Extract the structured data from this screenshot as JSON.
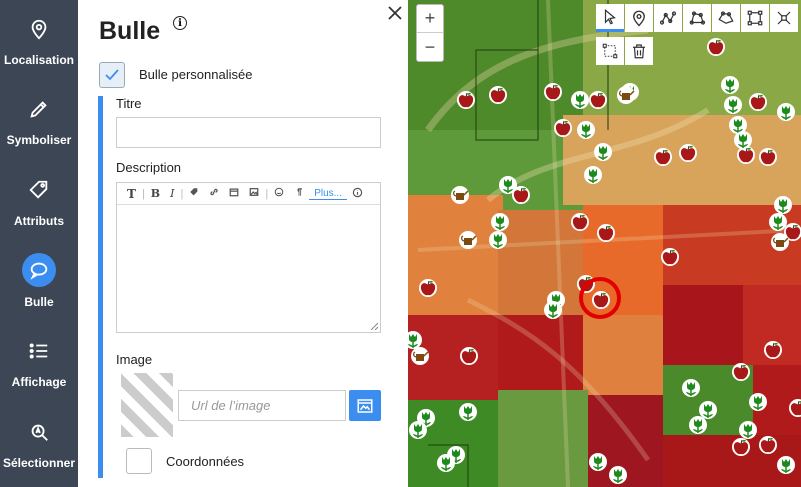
{
  "nav": {
    "items": [
      {
        "label": "Localisation",
        "icon": "location-pin-icon"
      },
      {
        "label": "Symboliser",
        "icon": "pencil-icon"
      },
      {
        "label": "Attributs",
        "icon": "tag-icon"
      },
      {
        "label": "Bulle",
        "icon": "speech-bubble-icon",
        "active": true
      },
      {
        "label": "Affichage",
        "icon": "list-icon"
      },
      {
        "label": "Sélectionner",
        "icon": "select-icon"
      }
    ]
  },
  "panel": {
    "title": "Bulle",
    "custom_bubble_label": "Bulle personnalisée",
    "custom_bubble_checked": true,
    "title_label": "Titre",
    "title_value": "",
    "description_label": "Description",
    "toolbar": [
      "T",
      "B",
      "I",
      "Plus..."
    ],
    "image_label": "Image",
    "url_placeholder": "Url de l’image",
    "coords_label": "Coordonnées",
    "coords_checked": false
  },
  "map": {
    "zoom_in": "+",
    "zoom_out": "−",
    "tools": [
      "select-tool-icon",
      "marker-tool-icon",
      "line-tool-icon",
      "polygon-tool-icon",
      "shape-tool-icon",
      "rectangle-tool-icon",
      "fit-tool-icon",
      "box-select-tool-icon",
      "delete-tool-icon"
    ]
  },
  "colors": {
    "nav_bg": "#3d4654",
    "accent": "#3b8ef0",
    "heat_red": "#b01a1a",
    "heat_orange": "#e86a2a",
    "heat_green": "#2f9a1f"
  }
}
